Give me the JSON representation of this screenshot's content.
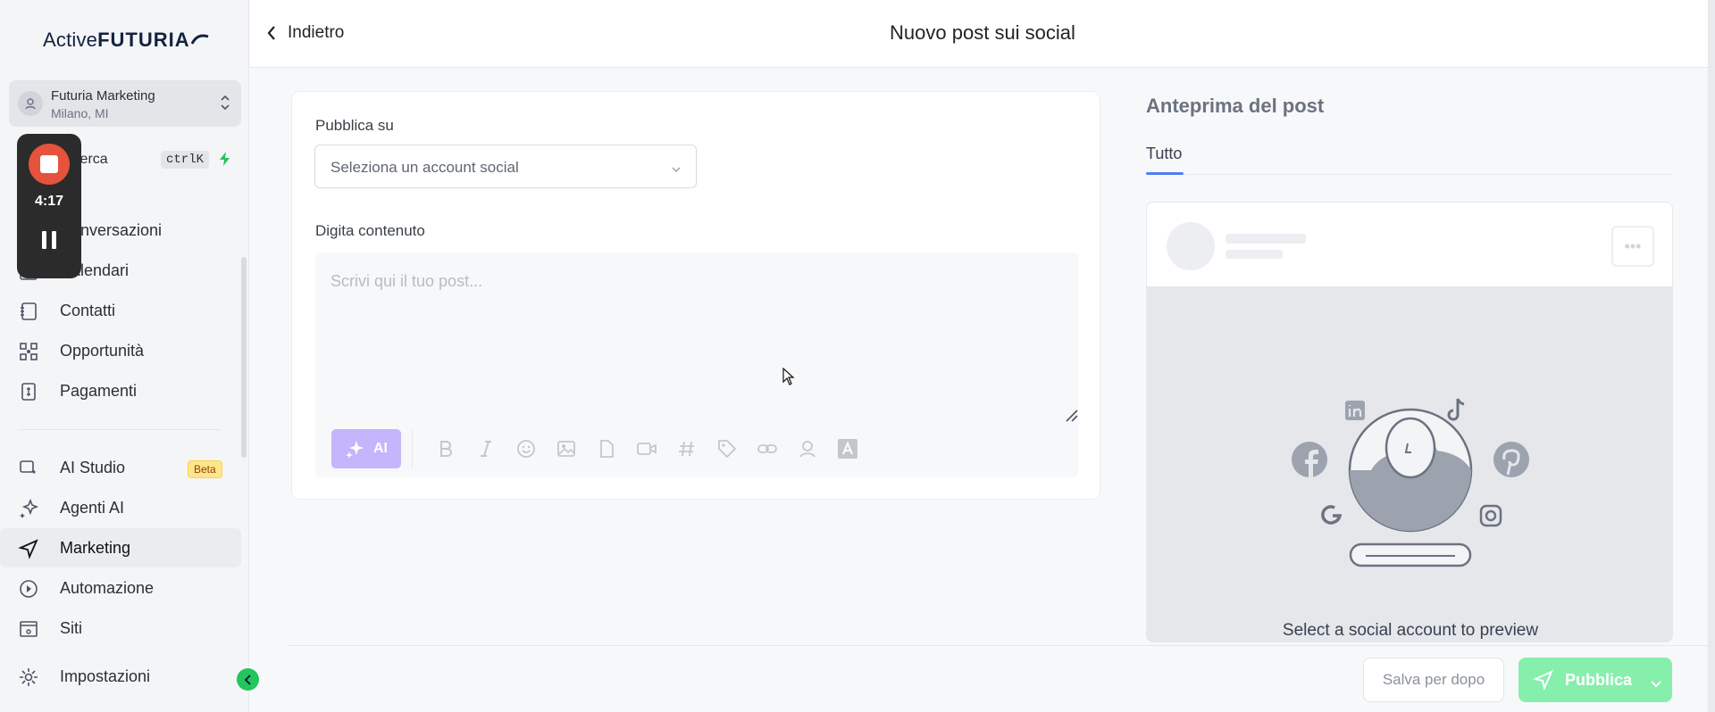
{
  "sidebar": {
    "logo": {
      "pre": "Active",
      "bold": "FUTURIA"
    },
    "account": {
      "name": "Futuria Marketing",
      "location": "Milano, MI"
    },
    "search": {
      "label": "Cerca",
      "shortcut": "ctrlK"
    },
    "items": [
      {
        "label": "Conversazioni",
        "icon": "chat-icon"
      },
      {
        "label": "Calendari",
        "icon": "calendar-icon"
      },
      {
        "label": "Contatti",
        "icon": "contacts-icon"
      },
      {
        "label": "Opportunità",
        "icon": "opportunities-icon"
      },
      {
        "label": "Pagamenti",
        "icon": "payments-icon"
      },
      {
        "label": "AI Studio",
        "icon": "ai-studio-icon",
        "badge": "Beta"
      },
      {
        "label": "Agenti AI",
        "icon": "sparkles-icon"
      },
      {
        "label": "Marketing",
        "icon": "send-icon",
        "active": true
      },
      {
        "label": "Automazione",
        "icon": "automation-icon"
      },
      {
        "label": "Siti",
        "icon": "sites-icon"
      },
      {
        "label": "Impostazioni",
        "icon": "gear-icon"
      }
    ]
  },
  "recorder": {
    "time": "4:17"
  },
  "header": {
    "back_label": "Indietro",
    "title": "Nuovo post sui social"
  },
  "form": {
    "publish_label": "Pubblica su",
    "account_placeholder": "Seleziona un account social",
    "content_label": "Digita contenuto",
    "content_placeholder": "Scrivi qui il tuo post...",
    "ai_label": "AI"
  },
  "preview": {
    "title": "Anteprima del post",
    "tab": "Tutto",
    "message": "Select a social account to preview"
  },
  "footer": {
    "save_label": "Salva per dopo",
    "publish_label": "Pubblica"
  },
  "colors": {
    "accent": "#4f7df3",
    "publish": "#86efac",
    "ai": "#c4b5fd",
    "beta": "#fde68a",
    "record": "#e5533d"
  }
}
